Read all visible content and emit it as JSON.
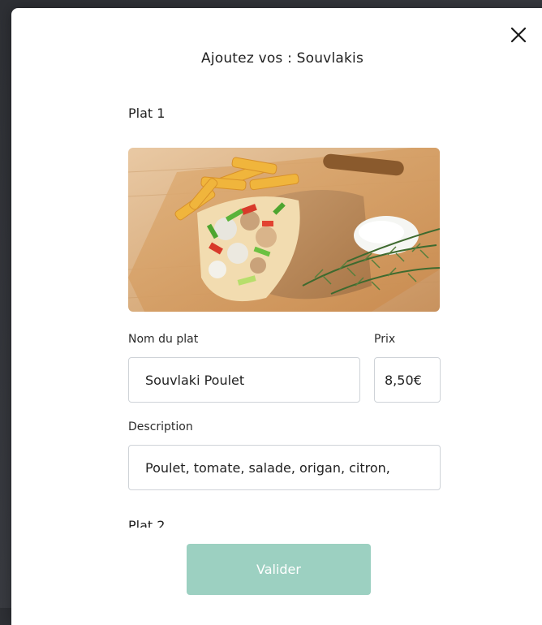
{
  "modal": {
    "title": "Ajoutez vos : Souvlakis",
    "close_icon": "close-icon",
    "validate_label": "Valider",
    "accent_color": "#9cd0c1"
  },
  "dishes": [
    {
      "heading": "Plat 1",
      "name_label": "Nom du plat",
      "name_value": "Souvlaki Poulet",
      "price_label": "Prix",
      "price_value": "8,50€",
      "description_label": "Description",
      "description_value": "Poulet, tomate, salade, origan, citron,"
    },
    {
      "heading": "Plat 2"
    }
  ]
}
